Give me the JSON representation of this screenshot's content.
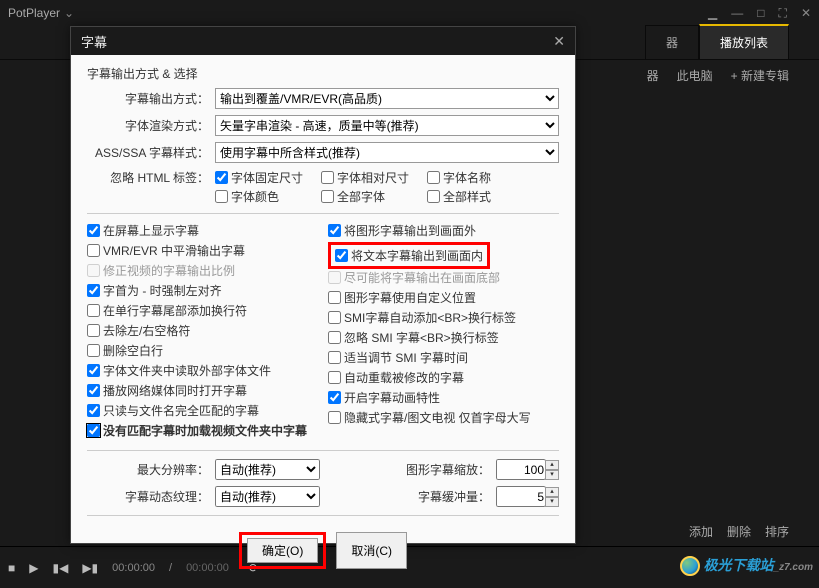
{
  "titlebar": {
    "app_name": "PotPlayer"
  },
  "tabs": {
    "device": "器",
    "playlist": "播放列表",
    "drive": "器",
    "thispc": "此电脑",
    "new_album": "+ 新建专辑"
  },
  "dialog": {
    "title": "字幕",
    "section1_title": "字幕输出方式 & 选择",
    "output_method_lbl": "字幕输出方式：",
    "output_method_val": "输出到覆盖/VMR/EVR(高品质)",
    "render_lbl": "字体渲染方式：",
    "render_val": "矢量字串渲染 - 高速，质量中等(推荐)",
    "assssa_lbl": "ASS/SSA 字幕样式：",
    "assssa_val": "使用字幕中所含样式(推荐)",
    "ignore_html_lbl": "忽略 HTML 标签：",
    "cb_fixed_size": "字体固定尺寸",
    "cb_rel_size": "字体相对尺寸",
    "cb_font_name": "字体名称",
    "cb_font_color": "字体颜色",
    "cb_all_font": "全部字体",
    "cb_all_style": "全部样式",
    "left": {
      "show_on_screen": "在屏幕上显示字幕",
      "vmr_smooth": "VMR/EVR 中平滑输出字幕",
      "fix_ratio": "修正视频的字幕输出比例",
      "first_align": "字首为 - 时强制左对齐",
      "single_line_nl": "在单行字幕尾部添加换行符",
      "trim_spaces": "去除左/右空格符",
      "del_blank": "删除空白行",
      "read_ext_font": "字体文件夹中读取外部字体文件",
      "open_sub_with_net": "播放网络媒体同时打开字幕",
      "only_full_match": "只读与文件名完全匹配的字幕",
      "load_folder_subs": "没有匹配字幕时加载视频文件夹中字幕"
    },
    "right": {
      "graphic_outside": "将图形字幕输出到画面外",
      "text_inside": "将文本字幕输出到画面内",
      "try_bottom": "尽可能将字幕输出在画面底部",
      "graphic_custom_pos": "图形字幕使用自定义位置",
      "smi_br": "SMI字幕自动添加<BR>换行标签",
      "ignore_smi_br": "忽略 SMI 字幕<BR>换行标签",
      "adjust_smi_time": "适当调节 SMI 字幕时间",
      "reload_modified": "自动重载被修改的字幕",
      "anim_effect": "开启字幕动画特性",
      "hide_uppercase": "隐藏式字幕/图文电视 仅首字母大写"
    },
    "max_res_lbl": "最大分辨率：",
    "max_res_val": "自动(推荐)",
    "graphic_scale_lbl": "图形字幕缩放：",
    "graphic_scale_val": "100",
    "dyn_texture_lbl": "字幕动态纹理：",
    "dyn_texture_val": "自动(推荐)",
    "buffer_lbl": "字幕缓冲量：",
    "buffer_val": "5",
    "ok_btn": "确定(O)",
    "cancel_btn": "取消(C)"
  },
  "playbar": {
    "time_cur": "00:00:00",
    "time_total": "00:00:00"
  },
  "bottom_actions": {
    "add": "添加",
    "del": "删除",
    "sort": "排序"
  },
  "watermark": "极光下载站"
}
